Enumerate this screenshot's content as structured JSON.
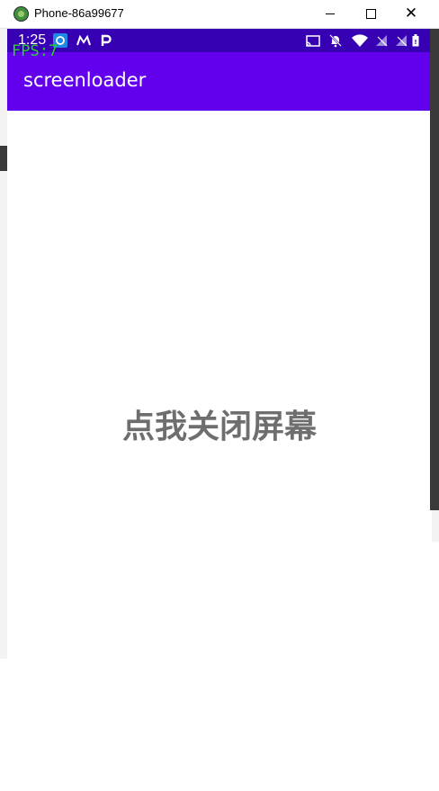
{
  "window": {
    "title": "Phone-86a99677",
    "minimize_icon": "minimize-icon",
    "maximize_icon": "maximize-icon",
    "close_glyph": "✕"
  },
  "statusbar": {
    "time": "1:25",
    "icons": [
      "sync-icon",
      "m-logo-icon",
      "p-logo-icon",
      "cast-icon",
      "notifications-off-icon",
      "wifi-icon",
      "signal-icon",
      "signal-icon",
      "battery-icon"
    ]
  },
  "overlay": {
    "fps": "FPS:7"
  },
  "appbar": {
    "title": "screenloader"
  },
  "main": {
    "close_screen_label": "点我关闭屏幕"
  },
  "colors": {
    "statusbar": "#3700b3",
    "appbar": "#6200ee",
    "fps_text": "#2bd22b",
    "label_text": "#6e6e6e"
  }
}
